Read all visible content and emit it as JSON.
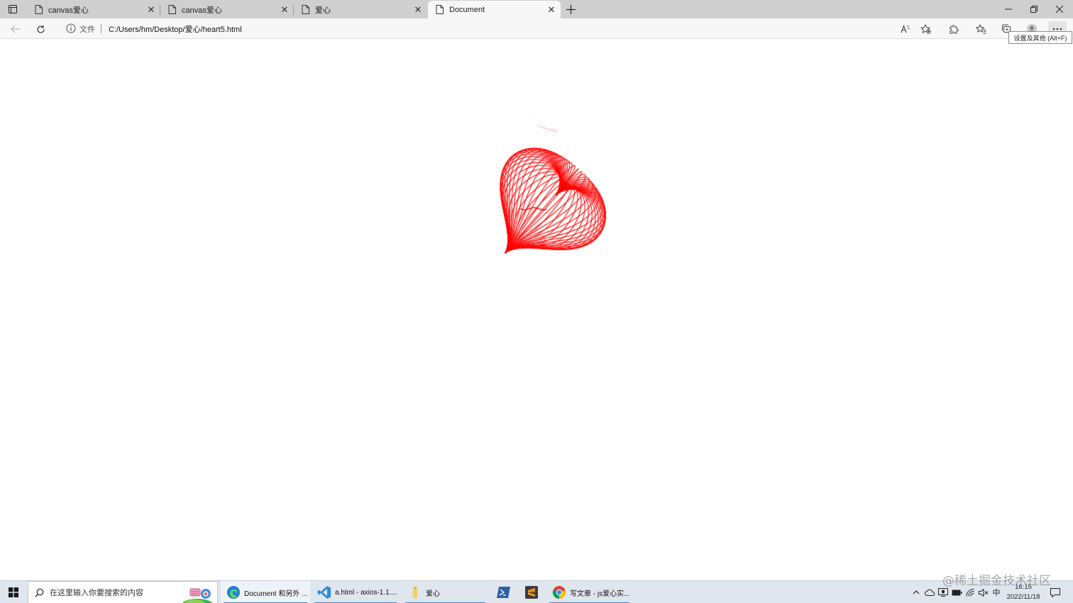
{
  "browser": {
    "tabs": [
      {
        "label": "canvas爱心",
        "active": false
      },
      {
        "label": "canvas爱心",
        "active": false
      },
      {
        "label": "爱心",
        "active": false
      },
      {
        "label": "Document",
        "active": true
      }
    ],
    "address": {
      "scheme_label": "文件",
      "url": "C:/Users/hm/Desktop/爱心/heart5.html"
    },
    "menu_tooltip": "设置及其他 (Alt+F)"
  },
  "page": {
    "heart_color": "#ff0000"
  },
  "taskbar": {
    "search_placeholder": "在这里输入你要搜索的内容",
    "apps": [
      {
        "label": "Document 和另外 ...",
        "icon": "edge-icon"
      },
      {
        "label": "a.html - axios-1.1....",
        "icon": "vscode-icon"
      },
      {
        "label": "爱心",
        "icon": "folder-icon"
      },
      {
        "label": "",
        "icon": "powershell-icon"
      },
      {
        "label": "",
        "icon": "sublime-icon"
      },
      {
        "label": "写文章 - js爱心实...",
        "icon": "chrome-icon"
      }
    ],
    "ime": "中",
    "time": "16:15",
    "date": "2022/11/18"
  },
  "watermark": "@稀土掘金技术社区"
}
